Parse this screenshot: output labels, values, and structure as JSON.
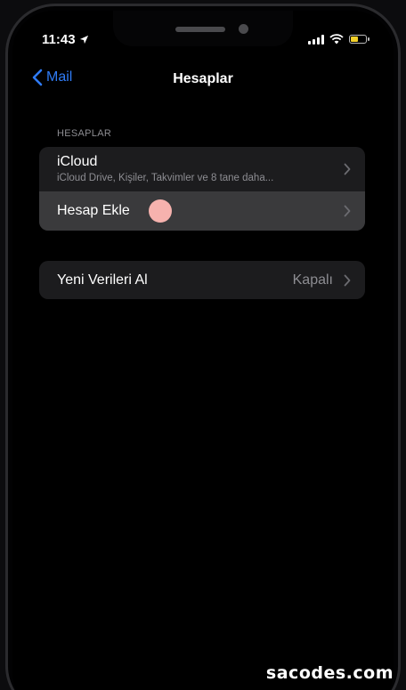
{
  "status_bar": {
    "time": "11:43",
    "battery_color": "#f2d02a",
    "battery_level": 0.55
  },
  "nav": {
    "back_label": "Mail",
    "title": "Hesaplar"
  },
  "accounts_section": {
    "header": "HESAPLAR",
    "rows": [
      {
        "title": "iCloud",
        "subtitle": "iCloud Drive, Kişiler, Takvimler ve 8 tane daha..."
      },
      {
        "title": "Hesap Ekle"
      }
    ]
  },
  "fetch_section": {
    "title": "Yeni Verileri Al",
    "value": "Kapalı"
  },
  "watermark": "sacodes.com",
  "colors": {
    "accent": "#2f7bf5",
    "touch_indicator": "#f6b2ae"
  }
}
